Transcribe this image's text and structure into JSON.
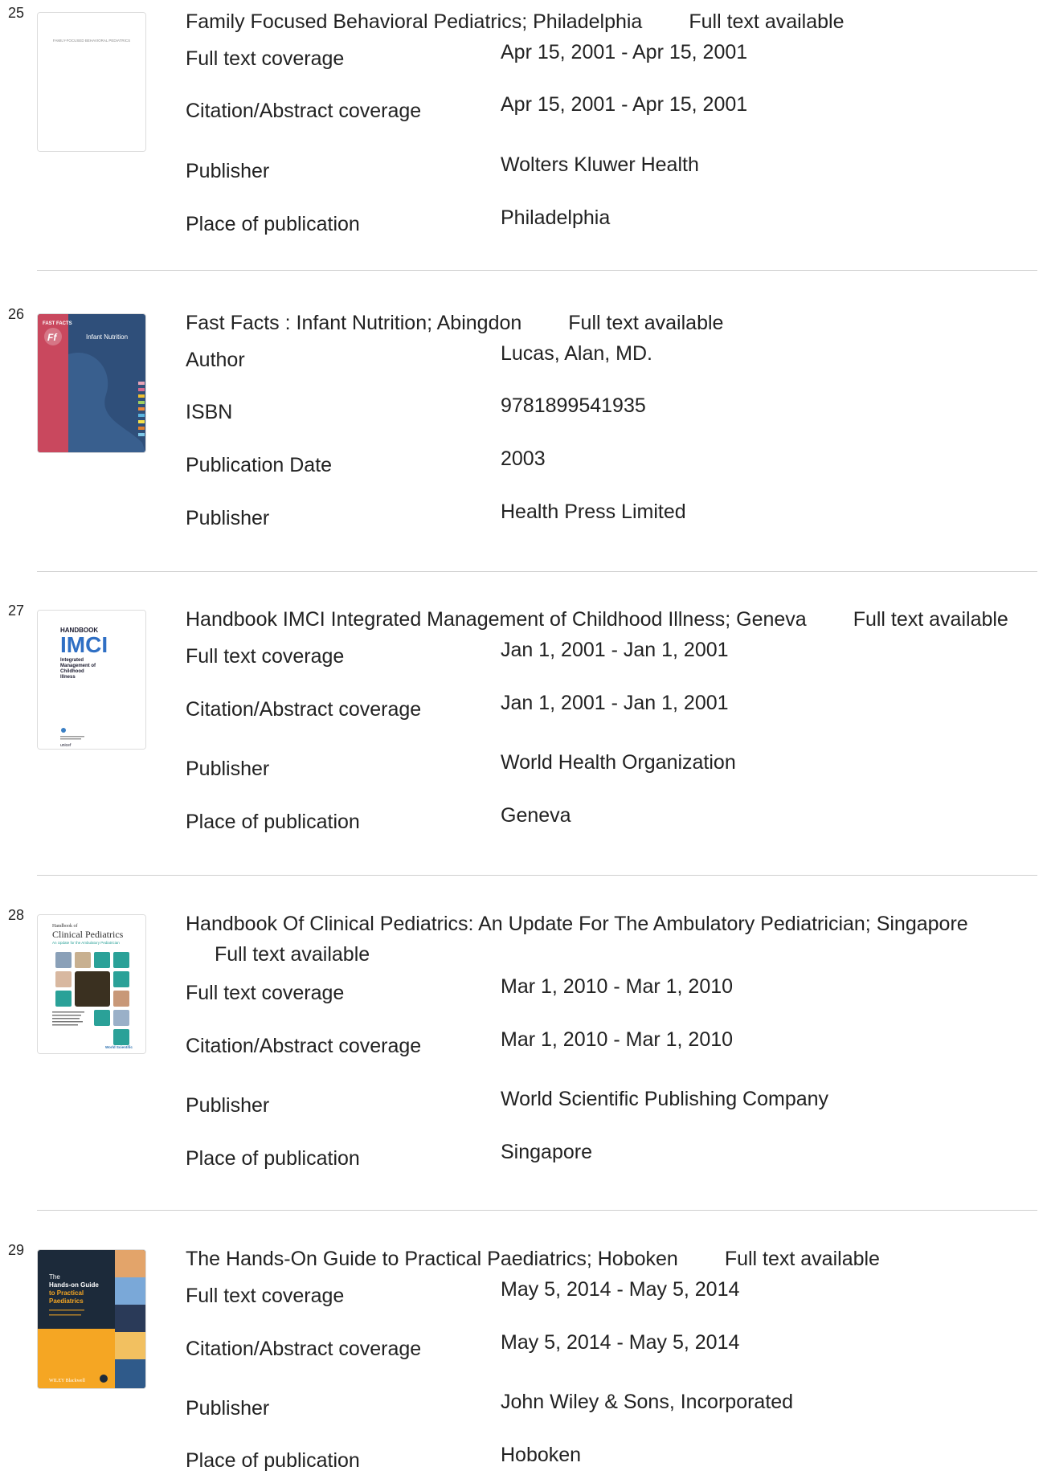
{
  "results": [
    {
      "number": "25",
      "title": "Family Focused Behavioral Pediatrics; Philadelphia",
      "full_text_label": "Full text available",
      "cover_text": [
        "FAMILY-FOCUSED BEHAVIORAL PEDIATRICS"
      ],
      "fields": [
        {
          "label": "Full text coverage",
          "value": "Apr 15, 2001 - Apr 15, 2001"
        },
        {
          "label": "Citation/Abstract coverage",
          "value": "Apr 15, 2001 - Apr 15, 2001"
        },
        {
          "label": "Publisher",
          "value": "Wolters Kluwer Health"
        },
        {
          "label": "Place of publication",
          "value": "Philadelphia"
        }
      ]
    },
    {
      "number": "26",
      "title": "Fast Facts : Infant Nutrition; Abingdon",
      "full_text_label": "Full text available",
      "cover_text": [
        "FAST FACTS",
        "Ff",
        "Infant Nutrition"
      ],
      "fields": [
        {
          "label": "Author",
          "value": "Lucas, Alan, MD."
        },
        {
          "label": "ISBN",
          "value": "9781899541935"
        },
        {
          "label": "Publication Date",
          "value": "2003"
        },
        {
          "label": "Publisher",
          "value": "Health Press Limited"
        }
      ]
    },
    {
      "number": "27",
      "title": "Handbook IMCI Integrated Management of Childhood Illness; Geneva",
      "full_text_label": "Full text available",
      "cover_text": [
        "HANDBOOK",
        "IMCI",
        "Integrated",
        "Management of",
        "Childhood",
        "Illness",
        "unicef"
      ],
      "fields": [
        {
          "label": "Full text coverage",
          "value": "Jan 1, 2001 - Jan 1, 2001"
        },
        {
          "label": "Citation/Abstract coverage",
          "value": "Jan 1, 2001 - Jan 1, 2001"
        },
        {
          "label": "Publisher",
          "value": "World Health Organization"
        },
        {
          "label": "Place of publication",
          "value": "Geneva"
        }
      ]
    },
    {
      "number": "28",
      "title": "Handbook Of Clinical Pediatrics: An Update For The Ambulatory Pediatrician; Singapore",
      "full_text_label": "Full text available",
      "cover_text": [
        "Handbook of",
        "Clinical Pediatrics",
        "An Update for the Ambulatory Pediatrician",
        "World Scientific"
      ],
      "fields": [
        {
          "label": "Full text coverage",
          "value": "Mar 1, 2010 - Mar 1, 2010"
        },
        {
          "label": "Citation/Abstract coverage",
          "value": "Mar 1, 2010 - Mar 1, 2010"
        },
        {
          "label": "Publisher",
          "value": "World Scientific Publishing Company"
        },
        {
          "label": "Place of publication",
          "value": "Singapore"
        }
      ]
    },
    {
      "number": "29",
      "title": "The Hands-On Guide to Practical Paediatrics; Hoboken",
      "full_text_label": "Full text available",
      "cover_text": [
        "The",
        "Hands-on Guide",
        "to Practical",
        "Paediatrics",
        "WILEY Blackwell"
      ],
      "fields": [
        {
          "label": "Full text coverage",
          "value": "May 5, 2014 - May 5, 2014"
        },
        {
          "label": "Citation/Abstract coverage",
          "value": "May 5, 2014 - May 5, 2014"
        },
        {
          "label": "Publisher",
          "value": "John Wiley & Sons, Incorporated"
        },
        {
          "label": "Place of publication",
          "value": "Hoboken"
        }
      ]
    }
  ]
}
